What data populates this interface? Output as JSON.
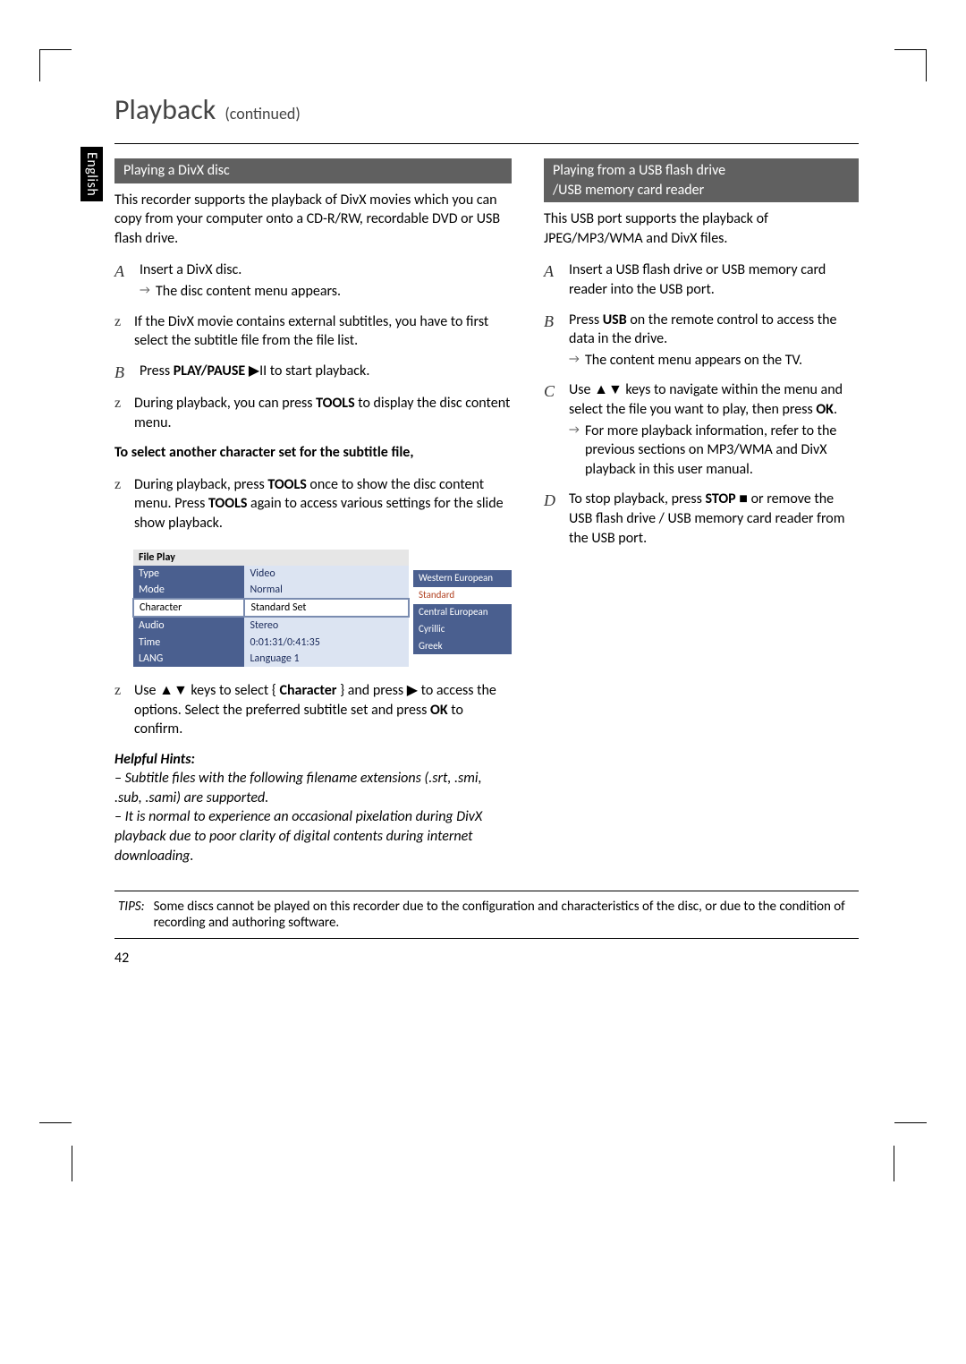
{
  "language_tab": "English",
  "title": {
    "main": "Playback",
    "sub": "(continued)"
  },
  "left": {
    "section_heading": "Playing a DivX disc",
    "intro": "This recorder supports the playback of DivX movies which you can copy from your computer onto a CD-R/RW, recordable DVD or USB flash drive.",
    "step1": {
      "marker": "A",
      "text": "Insert a DivX disc.",
      "sub": "The disc content menu appears."
    },
    "bullet1": {
      "marker": "z",
      "text": "If the DivX movie contains external subtitles, you have to first select the subtitle file from the file list."
    },
    "step2": {
      "marker": "B",
      "text_a": "Press ",
      "text_b": "PLAY/PAUSE",
      "text_c": " ▶II to start playback."
    },
    "bullet2": {
      "marker": "z",
      "text_a": "During playback, you can press ",
      "text_b": "TOOLS",
      "text_c": " to display the disc content menu."
    },
    "subtitle_heading": "To select another character set for the subtitle file,",
    "bullet3": {
      "marker": "z",
      "text_a": "During playback, press ",
      "text_b": "TOOLS",
      "text_c": " once to show the disc content menu. Press ",
      "text_d": "TOOLS",
      "text_e": " again to access various settings for the slide show playback."
    },
    "osd": {
      "title": "File Play",
      "rows": [
        {
          "label": "Type",
          "value": "Video"
        },
        {
          "label": "Mode",
          "value": "Normal"
        },
        {
          "label": "Character",
          "value": "Standard Set",
          "selected": true
        },
        {
          "label": "Audio",
          "value": "Stereo"
        },
        {
          "label": "Time",
          "value": "0:01:31/0:41:35"
        },
        {
          "label": "LANG",
          "value": "Language 1"
        }
      ],
      "dropdown": [
        "Western European",
        "Standard",
        "Central European",
        "Cyrillic",
        "Greek"
      ],
      "dropdown_selected_index": 1
    },
    "bullet4": {
      "marker": "z",
      "text_a": "Use ▲▼ keys to select { ",
      "text_b": "Character",
      "text_c": " } and press ▶ to access the options. Select the preferred subtitle set and press ",
      "text_d": "OK",
      "text_e": " to confirm."
    },
    "helpful_title": "Helpful Hints:",
    "help1": "– Subtitle files with the following filename extensions (.srt, .smi, .sub, .sami) are supported.",
    "help2": "– It is normal to experience an occasional pixelation during DivX playback due to poor clarity of digital contents during internet downloading."
  },
  "right": {
    "section_heading_l1": "Playing from a USB flash drive",
    "section_heading_l2": "/USB memory card reader",
    "intro": "This USB port supports the playback of JPEG/MP3/WMA and DivX files.",
    "step1": {
      "marker": "A",
      "text": "Insert a USB flash drive or USB memory card reader into the USB port."
    },
    "step2": {
      "marker": "B",
      "text_a": "Press ",
      "text_b": "USB",
      "text_c": " on the remote control to access the data in the drive.",
      "sub": "The content menu appears on the TV."
    },
    "step3": {
      "marker": "C",
      "text_a": "Use ▲▼ keys to navigate within the menu and select the file you want to play, then press ",
      "text_b": "OK",
      "text_c": ".",
      "sub": "For more playback information, refer to the previous sections on MP3/WMA and DivX playback in this user manual."
    },
    "step4": {
      "marker": "D",
      "text_a": "To stop playback, press ",
      "text_b": "STOP",
      "text_c": " ■ or remove the USB flash drive / USB memory card reader from the USB port."
    }
  },
  "tips": {
    "label": "TIPS:",
    "text": "Some discs cannot be played on this recorder due to the configuration and characteristics of the disc, or due to the condition of recording and authoring software."
  },
  "page_number": "42"
}
